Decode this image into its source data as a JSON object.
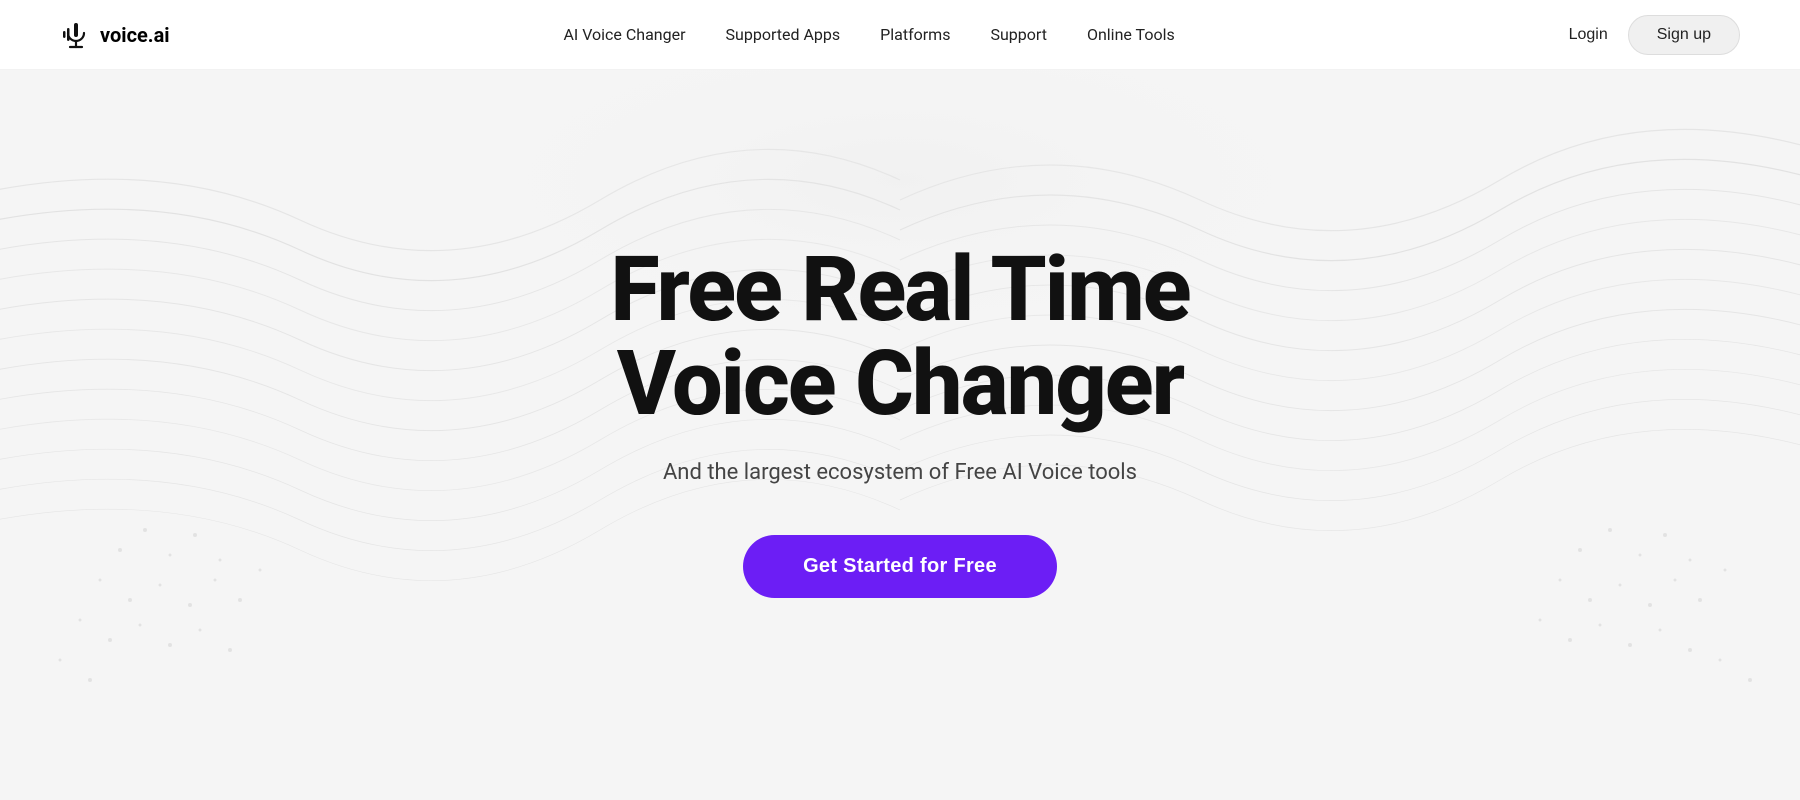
{
  "brand": {
    "name": "voice.ai",
    "logo_alt": "Voice AI Logo"
  },
  "nav": {
    "links": [
      {
        "id": "ai-voice-changer",
        "label": "AI Voice Changer"
      },
      {
        "id": "supported-apps",
        "label": "Supported Apps"
      },
      {
        "id": "platforms",
        "label": "Platforms"
      },
      {
        "id": "support",
        "label": "Support"
      },
      {
        "id": "online-tools",
        "label": "Online Tools"
      }
    ],
    "login_label": "Login",
    "signup_label": "Sign up"
  },
  "hero": {
    "title_line1": "Free Real Time",
    "title_line2": "Voice Changer",
    "subtitle": "And the largest ecosystem of Free AI Voice tools",
    "cta_label": "Get Started for Free"
  },
  "colors": {
    "cta_bg": "#6c1ef5",
    "cta_text": "#ffffff"
  }
}
